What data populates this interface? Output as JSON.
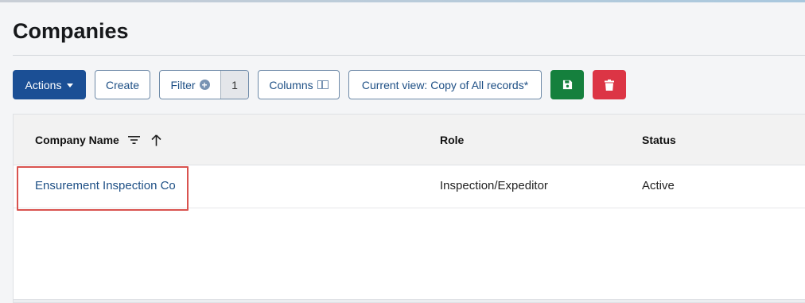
{
  "page": {
    "title": "Companies"
  },
  "toolbar": {
    "actions_label": "Actions",
    "create_label": "Create",
    "filter_label": "Filter",
    "filter_count": "1",
    "columns_label": "Columns",
    "view_label": "Current view: Copy of All records*"
  },
  "table": {
    "headers": {
      "company": "Company Name",
      "role": "Role",
      "status": "Status"
    },
    "rows": [
      {
        "company": "Ensurement Inspection Co",
        "role": "Inspection/Expeditor",
        "status": "Active"
      }
    ]
  },
  "colors": {
    "primary": "#1b4f95",
    "success": "#15803d",
    "danger": "#dc3545",
    "highlight": "#d9534f",
    "link": "#1d4f85"
  },
  "icons": [
    "caret-down-icon",
    "plus-circle-icon",
    "columns-icon",
    "save-icon",
    "trash-icon",
    "filter-lines-icon",
    "arrow-up-icon"
  ]
}
